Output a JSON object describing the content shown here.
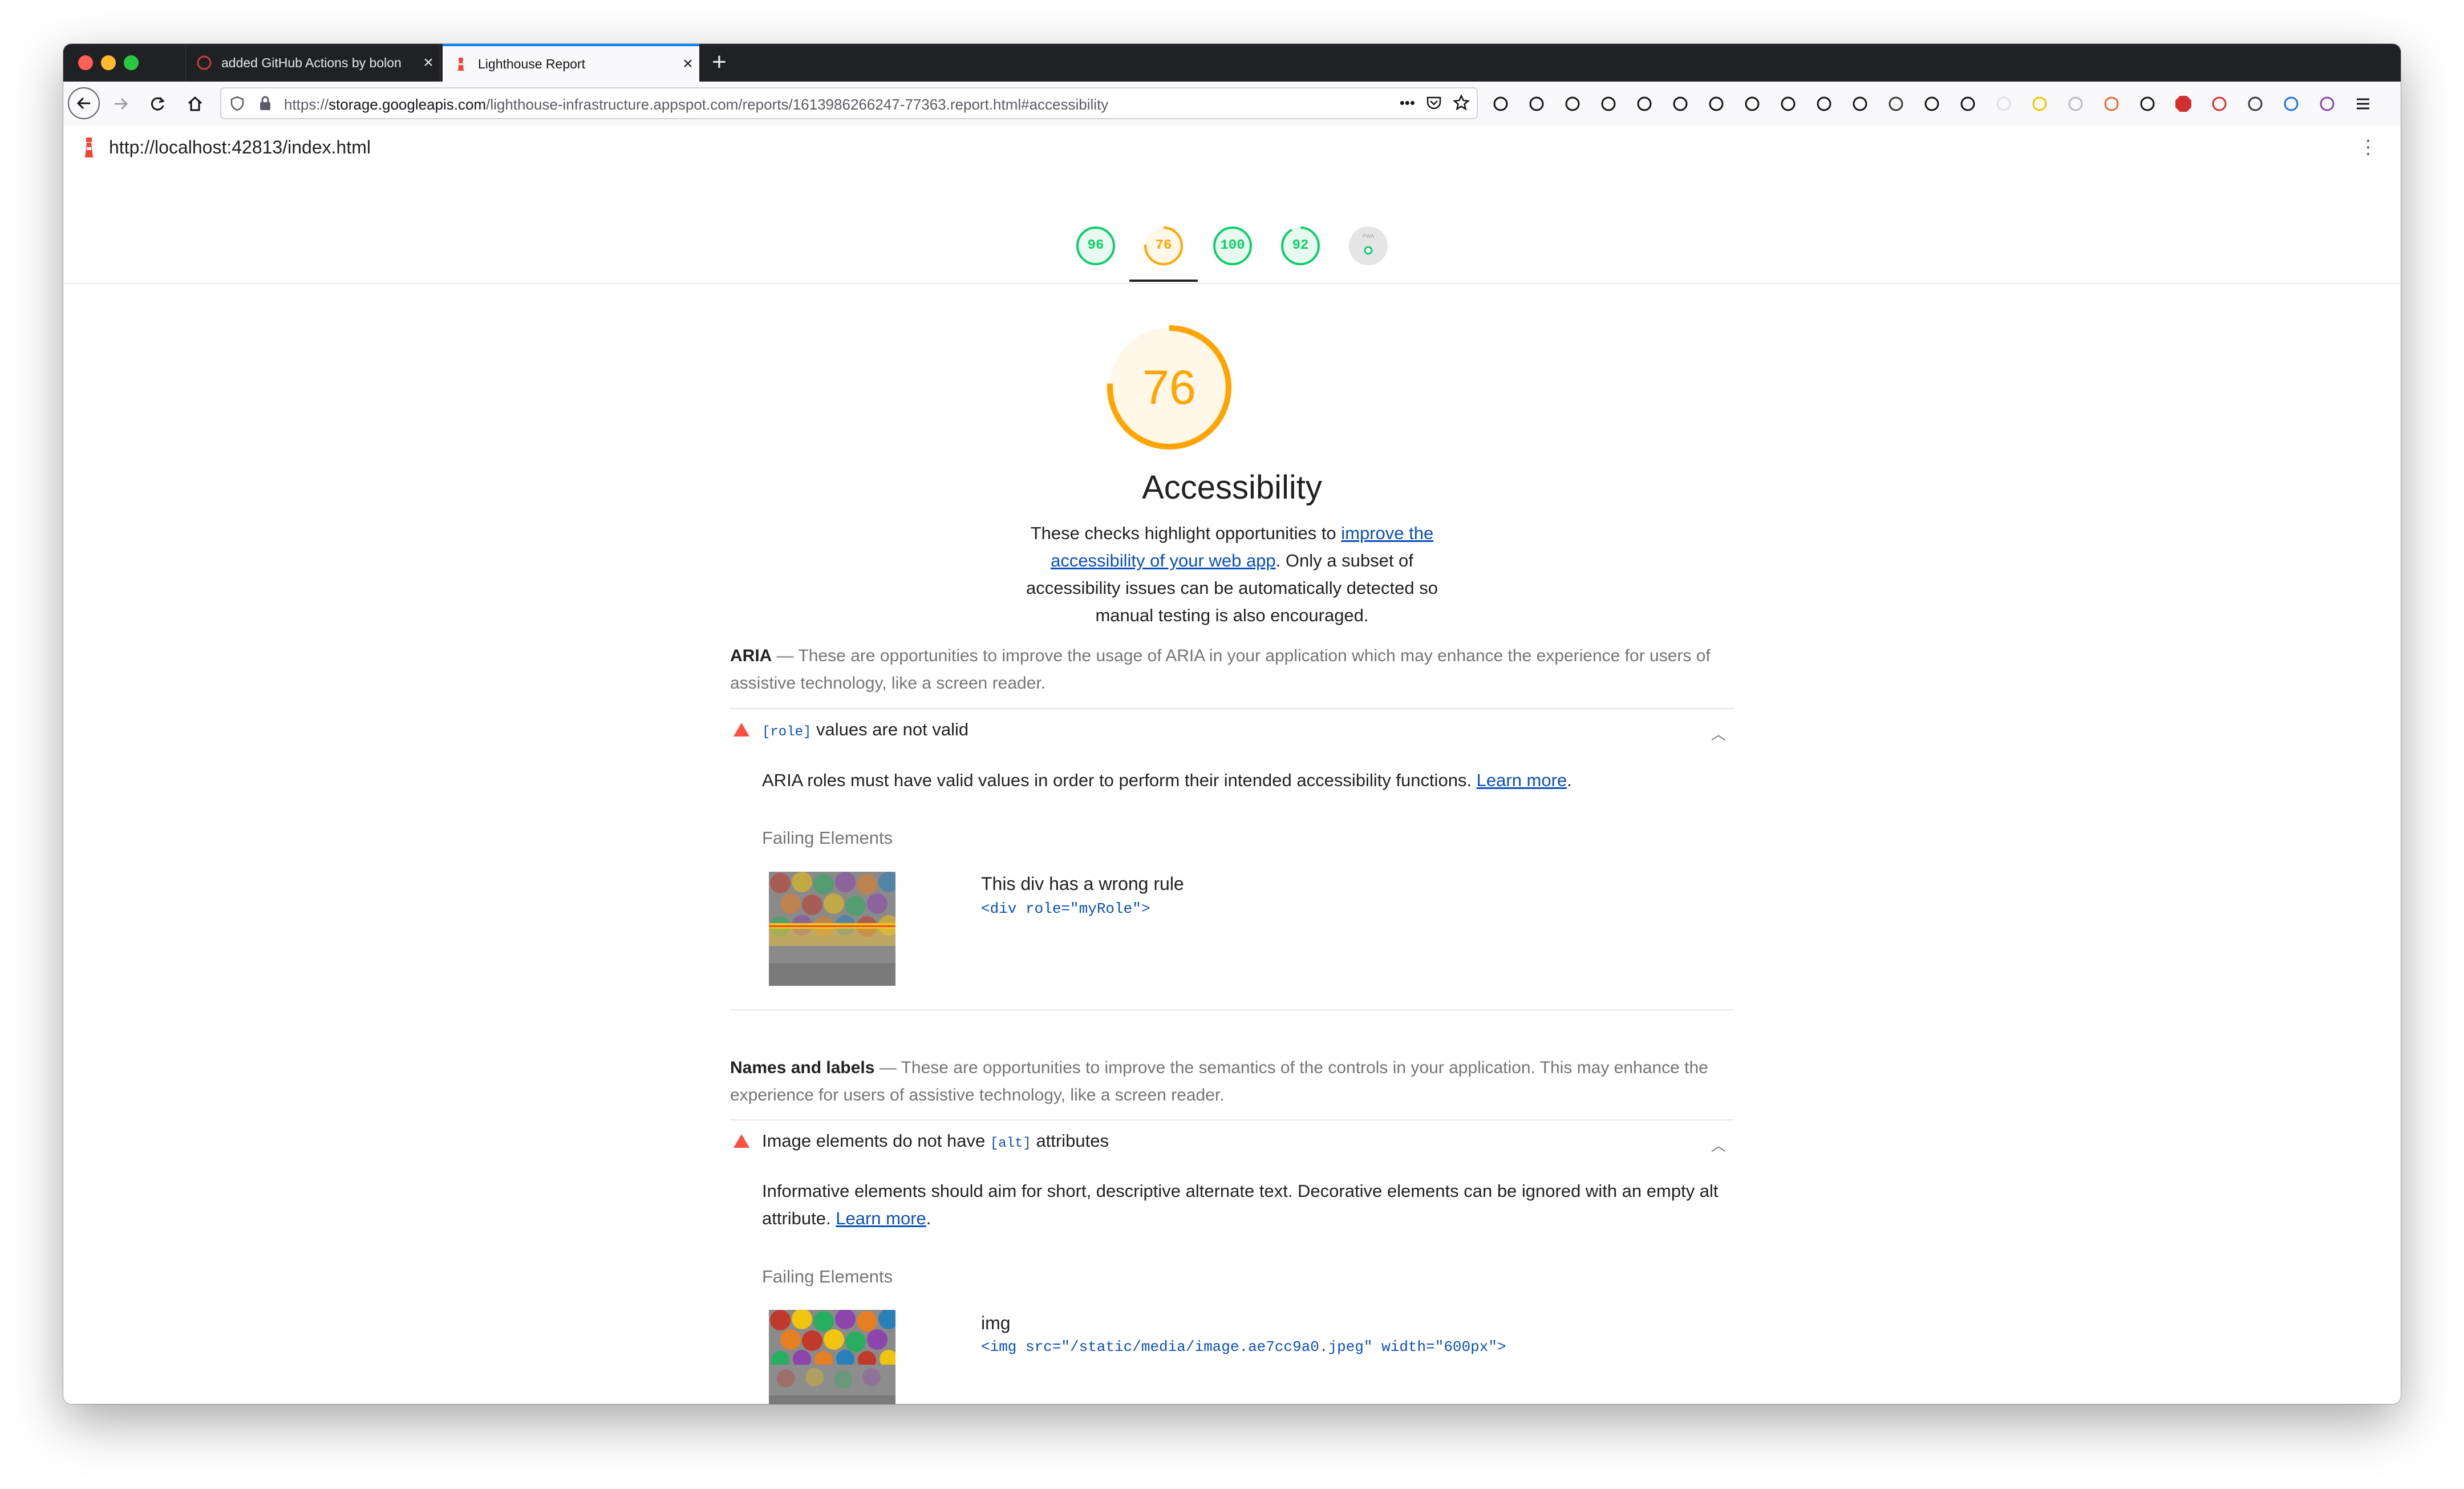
{
  "browser": {
    "tabs": [
      {
        "title": "added GitHub Actions by bolon",
        "active": false
      },
      {
        "title": "Lighthouse Report",
        "active": true
      }
    ],
    "url": {
      "prefix": "https://",
      "host": "storage.googleapis.com",
      "path": "/lighthouse-infrastructure.appspot.com/reports/1613986266247-77363.report.html#accessibility"
    },
    "toolbar_icons": [
      "more-icon",
      "pocket-icon",
      "bookmark-star-icon",
      "search-icon",
      "wrench-icon",
      "history-icon",
      "downloads-icon",
      "settings-icon",
      "scissors-icon",
      "copy-icon",
      "battery-icon",
      "library-icon",
      "sidebar-icon",
      "mask-icon",
      "puzzle-icon",
      "extension-icon",
      "extension-icon",
      "extension-icon",
      "extension-icon",
      "extension-icon",
      "crop-icon",
      "glasses-icon",
      "adblock-icon",
      "wordpress-icon",
      "drive-icon",
      "extension-icon",
      "cookie-icon",
      "menu-icon"
    ]
  },
  "app_bar": {
    "url": "http://localhost:42813/index.html"
  },
  "scores": [
    {
      "label": "96",
      "color": "#0cce6b"
    },
    {
      "label": "76",
      "color": "#ffa400"
    },
    {
      "label": "100",
      "color": "#0cce6b"
    },
    {
      "label": "92",
      "color": "#0cce6b"
    },
    {
      "label": "PWA",
      "color": "#9e9e9e"
    }
  ],
  "category": {
    "score": "76",
    "score_fraction": 0.76,
    "title": "Accessibility",
    "desc_pre": "These checks highlight opportunities to ",
    "desc_link": "improve the accessibility of your web app",
    "desc_post": ". Only a subset of accessibility issues can be automatically detected so manual testing is also encouraged."
  },
  "groups": [
    {
      "name": "ARIA",
      "desc": "These are opportunities to improve the usage of ARIA in your application which may enhance the experience for users of assistive technology, like a screen reader.",
      "audit": {
        "code": "[role]",
        "title": "values are not valid",
        "desc": "ARIA roles must have valid values in order to perform their intended accessibility functions. ",
        "learn_more": "Learn more",
        "failing_label": "Failing Elements",
        "node_label": "This div has a wrong rule",
        "snippet": "<div role=\"myRole\">"
      }
    },
    {
      "name": "Names and labels",
      "desc": "These are opportunities to improve the semantics of the controls in your application. This may enhance the experience for users of assistive technology, like a screen reader.",
      "audit": {
        "title_pre": "Image elements do not have ",
        "code": "[alt]",
        "title_post": " attributes",
        "desc": "Informative elements should aim for short, descriptive alternate text. Decorative elements can be ignored with an empty alt attribute. ",
        "learn_more": "Learn more",
        "failing_label": "Failing Elements",
        "node_label": "img",
        "snippet": "<img src=\"/static/media/image.ae7cc9a0.jpeg\" width=\"600px\">"
      }
    }
  ]
}
